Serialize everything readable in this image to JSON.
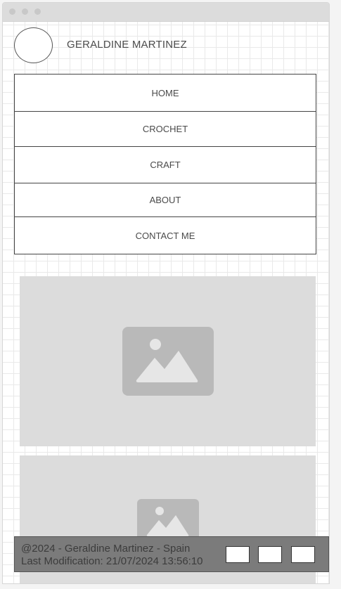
{
  "header": {
    "site_name": "GERALDINE MARTINEZ"
  },
  "nav": {
    "items": [
      {
        "label": "HOME"
      },
      {
        "label": "CROCHET"
      },
      {
        "label": "CRAFT"
      },
      {
        "label": "ABOUT"
      },
      {
        "label": "CONTACT ME"
      }
    ]
  },
  "main": {
    "images": [
      {
        "icon": "image-placeholder-icon"
      },
      {
        "icon": "image-placeholder-icon"
      }
    ]
  },
  "footer": {
    "copyright": "@2024 - Geraldine Martinez - Spain",
    "last_modification": "Last Modification: 21/07/2024 13:56:10",
    "social_links": [
      "social-link-1",
      "social-link-2",
      "social-link-3"
    ]
  },
  "colors": {
    "placeholder_bg": "#dcdcdc",
    "placeholder_icon": "#b9b9b9",
    "footer_bg": "#7b7b7b"
  }
}
